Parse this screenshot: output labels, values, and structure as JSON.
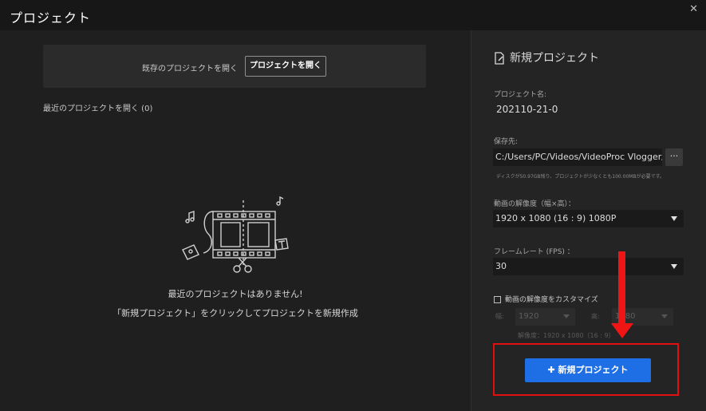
{
  "window": {
    "title": "プロジェクト",
    "close_glyph": "✕"
  },
  "left": {
    "open_existing_label": "既存のプロジェクトを開く",
    "open_button_label": "プロジェクトを開く",
    "recent_label": "最近のプロジェクトを開く (0)",
    "empty_title": "最近のプロジェクトはありません!",
    "empty_hint": "「新規プロジェクト」をクリックしてプロジェクトを新規作成"
  },
  "right": {
    "header": "新規プロジェクト",
    "header_icon": "edit-document-icon",
    "name_label": "プロジェクト名:",
    "name_value": "202110-21-0",
    "save_label": "保存先:",
    "save_path": "C:/Users/PC/Videos/VideoProc Vlogger/Proj",
    "browse_label": "···",
    "disk_hint": "ディスクが50.97GB残り、プロジェクトが少なくとも100.00MBが必要です。",
    "resolution_label": "動画の解像度（幅×高）：",
    "resolution_value": "1920 x 1080  (16 : 9)  1080P",
    "framerate_label": "フレームレート (FPS) ：",
    "framerate_value": "30",
    "customize_label": "動画の解像度をカスタマイズ",
    "width_label": "幅:",
    "width_value": "1920",
    "height_label": "高:",
    "height_value": "1080",
    "resolution_readout": "解像度：1920 x 1080（16 : 9）",
    "create_button_label": "新規プロジェクト",
    "create_button_icon": "plus-icon"
  },
  "colors": {
    "accent": "#1e6fe6",
    "annotation": "#e01010"
  }
}
